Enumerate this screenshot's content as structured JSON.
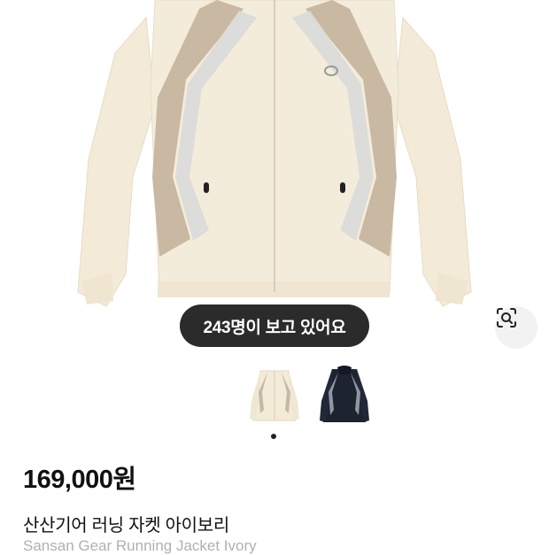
{
  "product": {
    "viewers_text": "243명이 보고 있어요",
    "price": "169,000원",
    "name_ko": "산산기어 러닝 자켓 아이보리",
    "name_en": "Sansan Gear Running Jacket Ivory"
  },
  "gallery": {
    "thumbnails": [
      {
        "label": "ivory-jacket-thumbnail",
        "color": "#f3ebd8",
        "accent": "#c7b8a5"
      },
      {
        "label": "navy-jacket-thumbnail",
        "color": "#1e2330",
        "accent": "#8f97a3"
      }
    ],
    "active_index": 0,
    "page_count": 1
  },
  "colors": {
    "jacket_body": "#f3ebd8",
    "jacket_panel": "#c9b8a2",
    "jacket_stripe": "#d9dbd9",
    "pill_bg": "#2b2b2b"
  },
  "icons": {
    "lens": "image-search-icon"
  }
}
